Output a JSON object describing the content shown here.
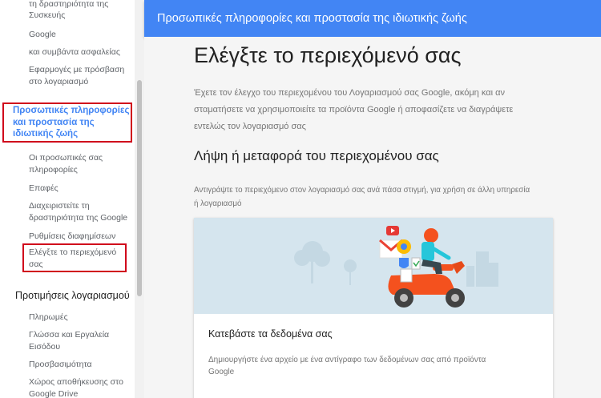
{
  "sidebar": {
    "items_top": [
      {
        "label": "τη δραστηριότητα της Συσκευής"
      },
      {
        "label": "Google"
      },
      {
        "label": "και συμβάντα ασφαλείας"
      },
      {
        "label": "Εφαρμογές με πρόσβαση"
      },
      {
        "label": "στο λογαριασμό"
      }
    ],
    "privacy_section_label": "Προσωπικές πληροφορίες και προστασία της ιδιωτικής ζωής",
    "privacy_items": [
      {
        "label": "Οι προσωπικές σας"
      },
      {
        "label": "πληροφορίες"
      },
      {
        "label": "Επαφές"
      },
      {
        "label": "Διαχειριστείτε τη"
      },
      {
        "label": "δραστηριότητα της Google"
      },
      {
        "label": "Ρυθμίσεις διαφημίσεων"
      },
      {
        "label": "Ελέγξτε το περιεχόμενό"
      },
      {
        "label": "σας"
      }
    ],
    "account_section_label": "Προτιμήσεις λογαριασμού",
    "account_items": [
      {
        "label": "Πληρωμές"
      },
      {
        "label": "Γλώσσα και Εργαλεία"
      },
      {
        "label": "Εισόδου"
      },
      {
        "label": "Προσβασιμότητα"
      },
      {
        "label": "Χώρος αποθήκευσης στο"
      },
      {
        "label": "Google Drive"
      }
    ]
  },
  "header": {
    "title": "Προσωπικές πληροφορίες και προστασία της ιδιωτικής ζωής"
  },
  "main": {
    "title": "Ελέγξτε το περιεχόμενό σας",
    "intro": "Έχετε τον έλεγχο του περιεχομένου του Λογαριασμού σας Google, ακόμη και αν σταματήσετε να χρησιμοποιείτε τα προϊόντα Google ή αποφασίζετε να διαγράψετε εντελώς τον λογαριασμό σας",
    "section_heading": "Λήψη ή μεταφορά του περιεχομένου σας",
    "section_desc": "Αντιγράψτε το περιεχόμενο στον λογαριασμό σας ανά πάσα στιγμή, για χρήση σε άλλη υπηρεσία ή λογαριασμό",
    "card": {
      "title": "Κατεβάστε τα δεδομένα σας",
      "desc": "Δημιουργήστε ένα αρχείο με ένα αντίγραφο των δεδομένων σας από προϊόντα Google"
    }
  },
  "colors": {
    "brand_blue": "#4285f4",
    "highlight_red": "#d0021b",
    "scooter_orange": "#f4511e"
  }
}
